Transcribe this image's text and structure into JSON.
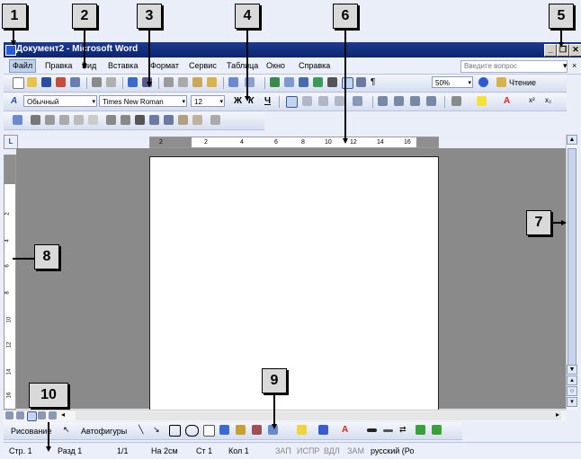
{
  "window": {
    "title": "Документ2 - Microsoft Word",
    "minimize_glyph": "_",
    "restore_glyph": "❐",
    "close_glyph": "✕"
  },
  "menu": {
    "items": [
      "Файл",
      "Правка",
      "Вид",
      "Вставка",
      "Формат",
      "Сервис",
      "Таблица",
      "Окно",
      "Справка"
    ],
    "ask_placeholder": "Введите вопрос",
    "close_glyph": "×"
  },
  "standard_toolbar": {
    "zoom": "50%",
    "reading_label": "Чтение"
  },
  "formatting_toolbar": {
    "style": "Обычный",
    "font": "Times New Roman",
    "size": "12",
    "bold": "Ж",
    "italic": "К",
    "underline": "Ч"
  },
  "ruler": {
    "marks": [
      "2",
      "2",
      "4",
      "6",
      "8",
      "10",
      "12",
      "14",
      "16"
    ]
  },
  "vertical_ruler": {
    "marks": [
      "2",
      "4",
      "6",
      "8",
      "10",
      "12",
      "14",
      "16"
    ]
  },
  "drawing_toolbar": {
    "drawing_label": "Рисование",
    "autoshapes_label": "Автофигуры"
  },
  "status_bar": {
    "page": "Стр. 1",
    "section": "Разд 1",
    "pages": "1/1",
    "at": "На 2см",
    "line": "Ст 1",
    "col": "Кол 1",
    "rec": "ЗАП",
    "trk": "ИСПР",
    "ext": "ВДЛ",
    "ovr": "ЗАМ",
    "language": "русский (Ро"
  },
  "callouts": [
    "1",
    "2",
    "3",
    "4",
    "5",
    "6",
    "7",
    "8",
    "9",
    "10"
  ]
}
